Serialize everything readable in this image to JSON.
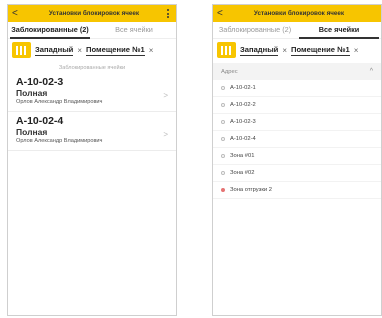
{
  "left": {
    "title": "Установки блокировок ячеек",
    "back_glyph": "<",
    "tabs": [
      "Заблокированные (2)",
      "Все ячейки"
    ],
    "filters": {
      "warehouse": "Западный",
      "room": "Помещение №1",
      "clear_glyph": "×"
    },
    "section_label": "Заблокированные ячейки",
    "cells": [
      {
        "code": "A-10-02-3",
        "status": "Полная",
        "user": "Орлов Александр Владимирович"
      },
      {
        "code": "A-10-02-4",
        "status": "Полная",
        "user": "Орлов Александр Владимирович"
      }
    ],
    "chevron_glyph": ">"
  },
  "right": {
    "title": "Установки блокировок ячеек",
    "back_glyph": "<",
    "tabs": [
      "Заблокированные (2)",
      "Все ячейки"
    ],
    "filters": {
      "warehouse": "Западный",
      "room": "Помещение №1",
      "clear_glyph": "×"
    },
    "list_header": "Адрес",
    "sort_glyph": "^",
    "rows": [
      {
        "label": "A-10-02-1",
        "blocked": false
      },
      {
        "label": "A-10-02-2",
        "blocked": false
      },
      {
        "label": "A-10-02-3",
        "blocked": false
      },
      {
        "label": "A-10-02-4",
        "blocked": false
      },
      {
        "label": "Зона #01",
        "blocked": false
      },
      {
        "label": "Зона #02",
        "blocked": false
      },
      {
        "label": "Зона отгрузки 2",
        "blocked": true
      }
    ]
  },
  "colors": {
    "accent": "#f7c500",
    "blocked": "#e57373"
  }
}
